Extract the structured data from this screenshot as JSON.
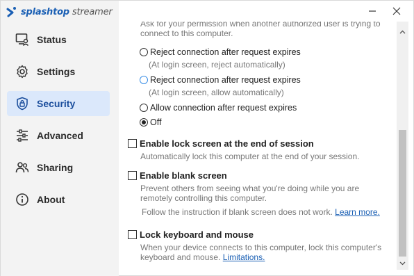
{
  "app": {
    "brand": "splashtop",
    "product": "streamer"
  },
  "window_controls": {
    "minimize_icon": "minimize-icon",
    "close_icon": "close-icon"
  },
  "sidebar": {
    "items": [
      {
        "label": "Status",
        "icon": "monitor-user-icon",
        "active": false
      },
      {
        "label": "Settings",
        "icon": "gear-icon",
        "active": false
      },
      {
        "label": "Security",
        "icon": "shield-lock-icon",
        "active": true
      },
      {
        "label": "Advanced",
        "icon": "sliders-icon",
        "active": false
      },
      {
        "label": "Sharing",
        "icon": "users-icon",
        "active": false
      },
      {
        "label": "About",
        "icon": "info-icon",
        "active": false
      }
    ]
  },
  "main": {
    "clipped_description": "Ask for your permission when another authorized user is trying to connect to this computer.",
    "radio_options": [
      {
        "label": "Reject connection after request expires",
        "sub": "(At login screen, reject automatically)",
        "checked": false
      },
      {
        "label": "Reject connection after request expires",
        "sub": "(At login screen, allow automatically)",
        "checked": false
      },
      {
        "label": "Allow connection after request expires",
        "sub": "",
        "checked": false
      },
      {
        "label": "Off",
        "sub": "",
        "checked": true
      }
    ],
    "lock_screen": {
      "label": "Enable lock screen at the end of session",
      "desc": "Automatically lock this computer at the end of your session.",
      "checked": false
    },
    "blank_screen": {
      "label": "Enable blank screen",
      "desc": "Prevent others from seeing what you're doing while you are remotely controlling this computer.",
      "follow": "Follow the instruction if blank screen does not work.",
      "link": "Learn more.",
      "checked": false
    },
    "lock_keyboard": {
      "label": "Lock keyboard and mouse",
      "desc": "When your device connects to this computer, lock this computer's keyboard and mouse.",
      "link": "Limitations.",
      "checked": false
    }
  },
  "colors": {
    "accent": "#1a5fb4",
    "active_bg": "#dbe8fb",
    "sidebar_bg": "#f3f3f3"
  }
}
